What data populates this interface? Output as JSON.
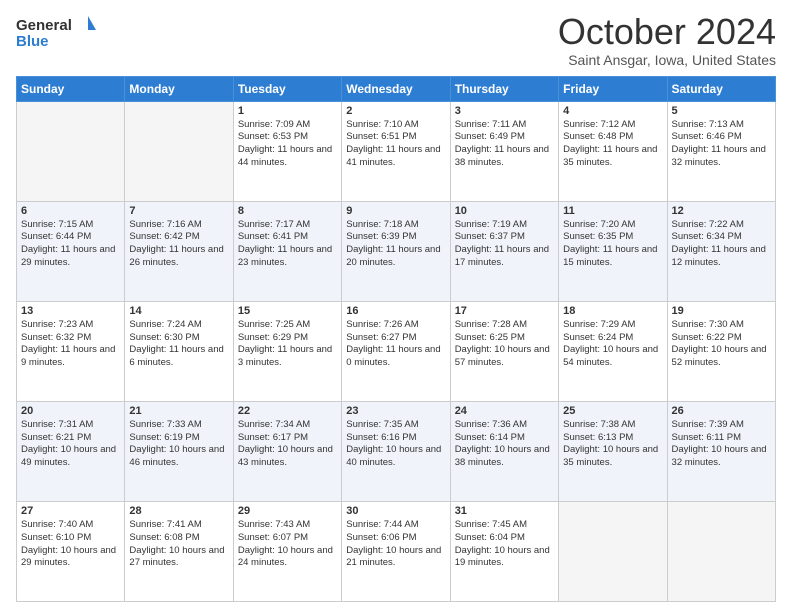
{
  "logo": {
    "line1": "General",
    "line2": "Blue"
  },
  "title": "October 2024",
  "subtitle": "Saint Ansgar, Iowa, United States",
  "weekdays": [
    "Sunday",
    "Monday",
    "Tuesday",
    "Wednesday",
    "Thursday",
    "Friday",
    "Saturday"
  ],
  "weeks": [
    [
      {
        "day": "",
        "empty": true
      },
      {
        "day": "",
        "empty": true
      },
      {
        "day": "1",
        "sunrise": "Sunrise: 7:09 AM",
        "sunset": "Sunset: 6:53 PM",
        "daylight": "Daylight: 11 hours and 44 minutes."
      },
      {
        "day": "2",
        "sunrise": "Sunrise: 7:10 AM",
        "sunset": "Sunset: 6:51 PM",
        "daylight": "Daylight: 11 hours and 41 minutes."
      },
      {
        "day": "3",
        "sunrise": "Sunrise: 7:11 AM",
        "sunset": "Sunset: 6:49 PM",
        "daylight": "Daylight: 11 hours and 38 minutes."
      },
      {
        "day": "4",
        "sunrise": "Sunrise: 7:12 AM",
        "sunset": "Sunset: 6:48 PM",
        "daylight": "Daylight: 11 hours and 35 minutes."
      },
      {
        "day": "5",
        "sunrise": "Sunrise: 7:13 AM",
        "sunset": "Sunset: 6:46 PM",
        "daylight": "Daylight: 11 hours and 32 minutes."
      }
    ],
    [
      {
        "day": "6",
        "sunrise": "Sunrise: 7:15 AM",
        "sunset": "Sunset: 6:44 PM",
        "daylight": "Daylight: 11 hours and 29 minutes."
      },
      {
        "day": "7",
        "sunrise": "Sunrise: 7:16 AM",
        "sunset": "Sunset: 6:42 PM",
        "daylight": "Daylight: 11 hours and 26 minutes."
      },
      {
        "day": "8",
        "sunrise": "Sunrise: 7:17 AM",
        "sunset": "Sunset: 6:41 PM",
        "daylight": "Daylight: 11 hours and 23 minutes."
      },
      {
        "day": "9",
        "sunrise": "Sunrise: 7:18 AM",
        "sunset": "Sunset: 6:39 PM",
        "daylight": "Daylight: 11 hours and 20 minutes."
      },
      {
        "day": "10",
        "sunrise": "Sunrise: 7:19 AM",
        "sunset": "Sunset: 6:37 PM",
        "daylight": "Daylight: 11 hours and 17 minutes."
      },
      {
        "day": "11",
        "sunrise": "Sunrise: 7:20 AM",
        "sunset": "Sunset: 6:35 PM",
        "daylight": "Daylight: 11 hours and 15 minutes."
      },
      {
        "day": "12",
        "sunrise": "Sunrise: 7:22 AM",
        "sunset": "Sunset: 6:34 PM",
        "daylight": "Daylight: 11 hours and 12 minutes."
      }
    ],
    [
      {
        "day": "13",
        "sunrise": "Sunrise: 7:23 AM",
        "sunset": "Sunset: 6:32 PM",
        "daylight": "Daylight: 11 hours and 9 minutes."
      },
      {
        "day": "14",
        "sunrise": "Sunrise: 7:24 AM",
        "sunset": "Sunset: 6:30 PM",
        "daylight": "Daylight: 11 hours and 6 minutes."
      },
      {
        "day": "15",
        "sunrise": "Sunrise: 7:25 AM",
        "sunset": "Sunset: 6:29 PM",
        "daylight": "Daylight: 11 hours and 3 minutes."
      },
      {
        "day": "16",
        "sunrise": "Sunrise: 7:26 AM",
        "sunset": "Sunset: 6:27 PM",
        "daylight": "Daylight: 11 hours and 0 minutes."
      },
      {
        "day": "17",
        "sunrise": "Sunrise: 7:28 AM",
        "sunset": "Sunset: 6:25 PM",
        "daylight": "Daylight: 10 hours and 57 minutes."
      },
      {
        "day": "18",
        "sunrise": "Sunrise: 7:29 AM",
        "sunset": "Sunset: 6:24 PM",
        "daylight": "Daylight: 10 hours and 54 minutes."
      },
      {
        "day": "19",
        "sunrise": "Sunrise: 7:30 AM",
        "sunset": "Sunset: 6:22 PM",
        "daylight": "Daylight: 10 hours and 52 minutes."
      }
    ],
    [
      {
        "day": "20",
        "sunrise": "Sunrise: 7:31 AM",
        "sunset": "Sunset: 6:21 PM",
        "daylight": "Daylight: 10 hours and 49 minutes."
      },
      {
        "day": "21",
        "sunrise": "Sunrise: 7:33 AM",
        "sunset": "Sunset: 6:19 PM",
        "daylight": "Daylight: 10 hours and 46 minutes."
      },
      {
        "day": "22",
        "sunrise": "Sunrise: 7:34 AM",
        "sunset": "Sunset: 6:17 PM",
        "daylight": "Daylight: 10 hours and 43 minutes."
      },
      {
        "day": "23",
        "sunrise": "Sunrise: 7:35 AM",
        "sunset": "Sunset: 6:16 PM",
        "daylight": "Daylight: 10 hours and 40 minutes."
      },
      {
        "day": "24",
        "sunrise": "Sunrise: 7:36 AM",
        "sunset": "Sunset: 6:14 PM",
        "daylight": "Daylight: 10 hours and 38 minutes."
      },
      {
        "day": "25",
        "sunrise": "Sunrise: 7:38 AM",
        "sunset": "Sunset: 6:13 PM",
        "daylight": "Daylight: 10 hours and 35 minutes."
      },
      {
        "day": "26",
        "sunrise": "Sunrise: 7:39 AM",
        "sunset": "Sunset: 6:11 PM",
        "daylight": "Daylight: 10 hours and 32 minutes."
      }
    ],
    [
      {
        "day": "27",
        "sunrise": "Sunrise: 7:40 AM",
        "sunset": "Sunset: 6:10 PM",
        "daylight": "Daylight: 10 hours and 29 minutes."
      },
      {
        "day": "28",
        "sunrise": "Sunrise: 7:41 AM",
        "sunset": "Sunset: 6:08 PM",
        "daylight": "Daylight: 10 hours and 27 minutes."
      },
      {
        "day": "29",
        "sunrise": "Sunrise: 7:43 AM",
        "sunset": "Sunset: 6:07 PM",
        "daylight": "Daylight: 10 hours and 24 minutes."
      },
      {
        "day": "30",
        "sunrise": "Sunrise: 7:44 AM",
        "sunset": "Sunset: 6:06 PM",
        "daylight": "Daylight: 10 hours and 21 minutes."
      },
      {
        "day": "31",
        "sunrise": "Sunrise: 7:45 AM",
        "sunset": "Sunset: 6:04 PM",
        "daylight": "Daylight: 10 hours and 19 minutes."
      },
      {
        "day": "",
        "empty": true
      },
      {
        "day": "",
        "empty": true
      }
    ]
  ]
}
